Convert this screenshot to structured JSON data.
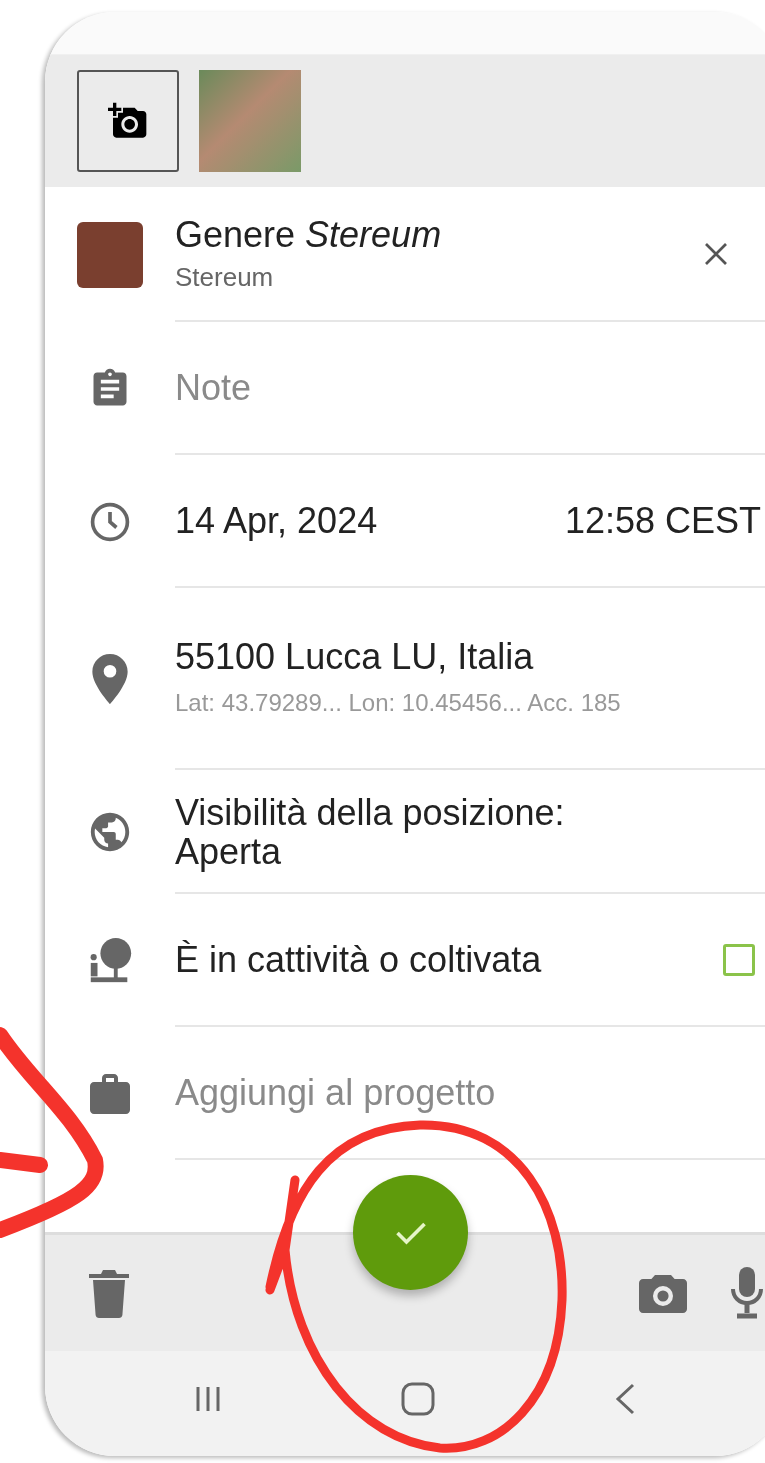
{
  "taxon": {
    "title": "Genere *Stereum*",
    "subtitle": "Stereum"
  },
  "notes": {
    "placeholder": "Note"
  },
  "datetime": {
    "date": "14 Apr, 2024",
    "time": "12:58 CEST"
  },
  "location": {
    "place": "55100 Lucca LU, Italia",
    "details": "Lat: 43.79289...  Lon: 10.45456...  Acc. 185"
  },
  "visibility": {
    "label": "Visibilità della posizione:",
    "value": "Aperta"
  },
  "captive": {
    "label": "È in cattività o coltivata",
    "checked": false
  },
  "project": {
    "placeholder": "Aggiungi al progetto"
  }
}
